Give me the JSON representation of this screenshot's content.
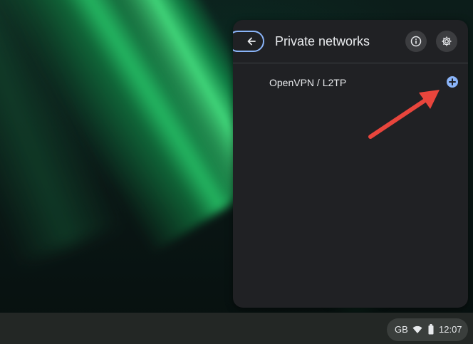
{
  "panel": {
    "title": "Private networks",
    "back_icon": "arrow-left-icon",
    "info_icon": "info-icon",
    "settings_icon": "gear-icon"
  },
  "vpn": {
    "items": [
      {
        "label": "OpenVPN / L2TP",
        "action_icon": "add-circle-icon"
      }
    ]
  },
  "annotation": {
    "icon": "arrow-icon",
    "color": "#e8453c"
  },
  "tray": {
    "language": "GB",
    "wifi_icon": "wifi-icon",
    "battery_icon": "battery-icon",
    "time": "12:07"
  },
  "colors": {
    "accent": "#8ab4f8",
    "panel_bg": "#202124",
    "text": "#e8eaed"
  }
}
